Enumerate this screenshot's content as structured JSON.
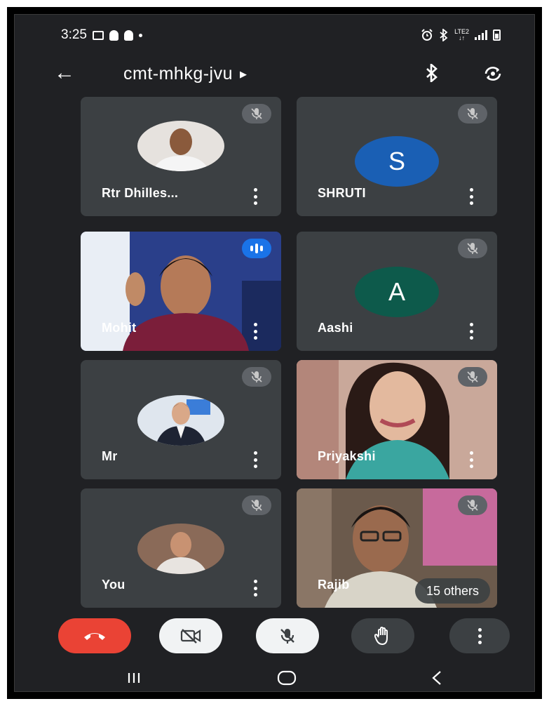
{
  "status_bar": {
    "time": "3:25",
    "network": "LTE2",
    "icons": [
      "gallery-icon",
      "snapchat-icon",
      "snapchat-icon",
      "notification-dot",
      "alarm-icon",
      "bluetooth-icon",
      "lte-icon",
      "signal-icon",
      "battery-icon"
    ]
  },
  "app_bar": {
    "meeting_code": "cmt-mhkg-jvu",
    "icons": [
      "back-arrow-icon",
      "bluetooth-audio-icon",
      "switch-camera-icon"
    ]
  },
  "participants": [
    {
      "name": "Rtr Dhilles...",
      "avatar": "photo",
      "muted": true
    },
    {
      "name": "SHRUTI",
      "avatar": "letter",
      "letter": "S",
      "avatar_color": "#1a5fb4",
      "muted": true
    },
    {
      "name": "Mohit",
      "avatar": "video",
      "muted": false,
      "speaking": true
    },
    {
      "name": "Aashi",
      "avatar": "letter",
      "letter": "A",
      "avatar_color": "#0d5a4b",
      "muted": true
    },
    {
      "name": "Mr",
      "avatar": "photo",
      "muted": true
    },
    {
      "name": "Priyakshi",
      "avatar": "video",
      "muted": true
    },
    {
      "name": "You",
      "avatar": "photo",
      "muted": true
    },
    {
      "name": "Rajib",
      "avatar": "video",
      "muted": true
    }
  ],
  "others_badge": "15 others",
  "controls": {
    "end_call_color": "#ea4335",
    "icons": [
      "end-call-icon",
      "camera-off-icon",
      "mic-off-icon",
      "raise-hand-icon",
      "more-options-icon"
    ]
  },
  "nav_bar": {
    "icons": [
      "recent-apps-icon",
      "home-icon",
      "back-icon"
    ]
  },
  "colors": {
    "background": "#202124",
    "tile": "#3c4043",
    "speaking_accent": "#1a73e8"
  }
}
